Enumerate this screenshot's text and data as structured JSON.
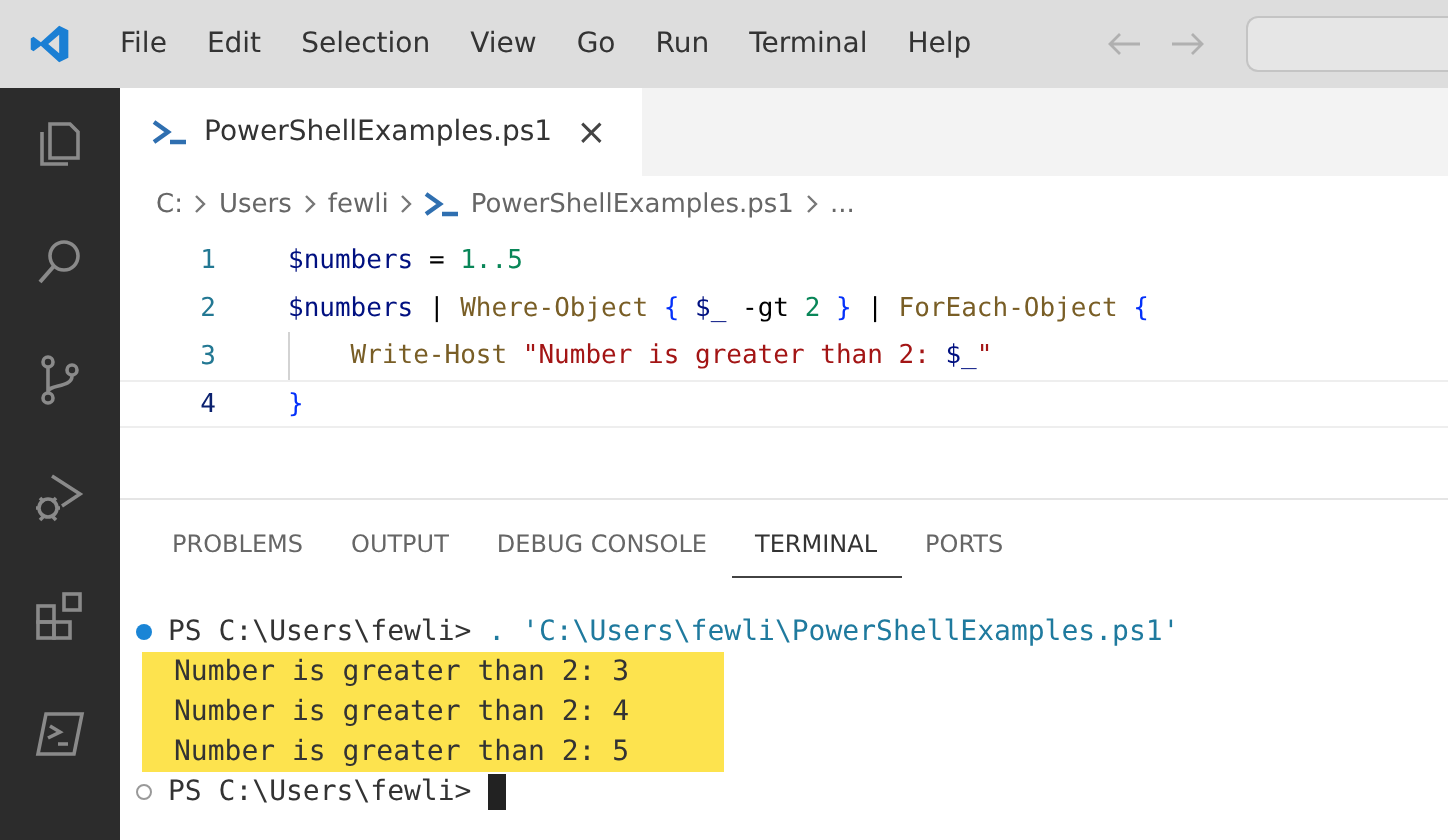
{
  "menu": [
    "File",
    "Edit",
    "Selection",
    "View",
    "Go",
    "Run",
    "Terminal",
    "Help"
  ],
  "tabs": [
    {
      "label": "PowerShellExamples.ps1",
      "close": "×",
      "selected": true
    }
  ],
  "breadcrumb": [
    "C:",
    "Users",
    "fewli",
    "PowerShellExamples.ps1",
    "..."
  ],
  "code": [
    {
      "number": "1",
      "tokens": [
        {
          "text": "$numbers",
          "kind": "variable"
        },
        {
          "text": " = ",
          "kind": "plain"
        },
        {
          "text": "1..5",
          "kind": "number"
        }
      ]
    },
    {
      "number": "2",
      "tokens": [
        {
          "text": "$numbers",
          "kind": "variable"
        },
        {
          "text": " | ",
          "kind": "plain"
        },
        {
          "text": "Where-Object",
          "kind": "cmdlet"
        },
        {
          "text": " { ",
          "kind": "brace"
        },
        {
          "text": "$_",
          "kind": "variable"
        },
        {
          "text": " -gt ",
          "kind": "plain"
        },
        {
          "text": "2",
          "kind": "number"
        },
        {
          "text": " } ",
          "kind": "brace"
        },
        {
          "text": "| ",
          "kind": "plain"
        },
        {
          "text": "ForEach-Object",
          "kind": "cmdlet"
        },
        {
          "text": " {",
          "kind": "brace"
        }
      ]
    },
    {
      "number": "3",
      "indent": true,
      "tokens": [
        {
          "text": "Write-Host",
          "kind": "cmdlet"
        },
        {
          "text": " \"Number is greater than 2: ",
          "kind": "string"
        },
        {
          "text": "$_",
          "kind": "variable"
        },
        {
          "text": "\"",
          "kind": "string"
        }
      ]
    },
    {
      "number": "4",
      "current": true,
      "tokens": [
        {
          "text": "}",
          "kind": "brace"
        }
      ]
    }
  ],
  "panel_tabs": [
    {
      "label": "PROBLEMS",
      "selected": false
    },
    {
      "label": "OUTPUT",
      "selected": false
    },
    {
      "label": "DEBUG CONSOLE",
      "selected": false
    },
    {
      "label": "TERMINAL",
      "selected": true
    },
    {
      "label": "PORTS",
      "selected": false
    }
  ],
  "terminal": {
    "command": {
      "prompt": "PS C:\\Users\\fewli> ",
      "text": ". 'C:\\Users\\fewli\\PowerShellExamples.ps1'",
      "finished": true
    },
    "output": [
      "Number is greater than 2: 3",
      "Number is greater than 2: 4",
      "Number is greater than 2: 5"
    ],
    "prompt": {
      "prompt": "PS C:\\Users\\fewli> ",
      "finished": false
    }
  }
}
